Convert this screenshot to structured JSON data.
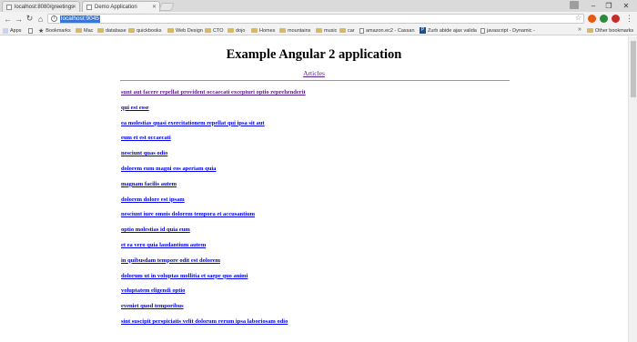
{
  "tabs": [
    {
      "label": "localhost:8080/greetings"
    },
    {
      "label": "Demo Application"
    }
  ],
  "address_bar": {
    "url": "localhost:9045"
  },
  "bookmarks": {
    "items": [
      {
        "label": "Apps",
        "icon": "apps-icon"
      },
      {
        "label": "",
        "icon": "page-icon"
      },
      {
        "label": "Bookmarks",
        "icon": "star-icon"
      },
      {
        "label": "Mac",
        "icon": "folder-icon"
      },
      {
        "label": "database",
        "icon": "folder-icon"
      },
      {
        "label": "quickbooks",
        "icon": "folder-icon"
      },
      {
        "label": "Web Design",
        "icon": "folder-icon"
      },
      {
        "label": "CTO",
        "icon": "folder-icon"
      },
      {
        "label": "dojo",
        "icon": "folder-icon"
      },
      {
        "label": "Homes",
        "icon": "folder-icon"
      },
      {
        "label": "mountains",
        "icon": "folder-icon"
      },
      {
        "label": "music",
        "icon": "folder-icon"
      },
      {
        "label": "car",
        "icon": "folder-icon"
      },
      {
        "label": "amazon.ec2 - Cassan",
        "icon": "page-icon"
      },
      {
        "label": "Zurb abide ajax valida",
        "icon": "p-icon"
      },
      {
        "label": "javascript - Dynamic -",
        "icon": "page-icon"
      }
    ],
    "other_label": "Other bookmarks"
  },
  "page": {
    "title": "Example Angular 2 application",
    "nav_link": "Articles",
    "articles": [
      "sunt aut facere repellat provident occaecati excepturi optio reprehenderit",
      "qui est esse",
      "ea molestias quasi exercitationem repellat qui ipsa sit aut",
      "eum et est occaecati",
      "nesciunt quas odio",
      "dolorem eum magni eos aperiam quia",
      "magnam facilis autem",
      "dolorem dolore est ipsam",
      "nesciunt iure omnis dolorem tempora et accusantium",
      "optio molestias id quia eum",
      "et ea vero quia laudantium autem",
      "in quibusdam tempore odit est dolorem",
      "dolorum ut in voluptas mollitia et saepe quo animi",
      "voluptatem eligendi optio",
      "eveniet quod temporibus",
      "sint suscipit perspiciatis velit dolorum rerum ipsa laboriosam odio"
    ]
  }
}
